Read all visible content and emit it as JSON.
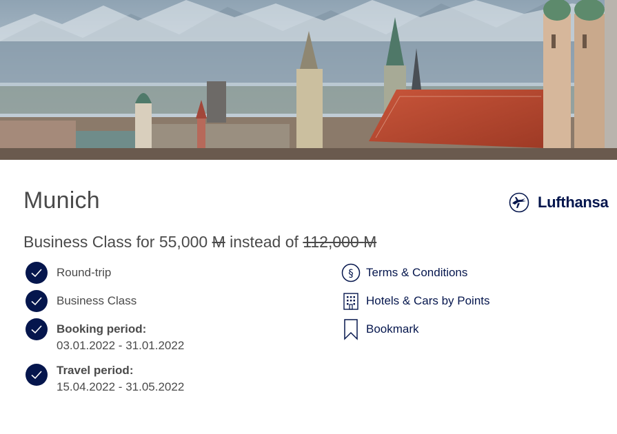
{
  "destination": {
    "title": "Munich"
  },
  "brand": {
    "name": "Lufthansa",
    "logo_icon": "crane-logo-icon",
    "color": "#05164d"
  },
  "offer": {
    "prefix": "Business Class for 55,000",
    "unit": "M",
    "middle": "instead of",
    "old_price": "112,000",
    "old_unit": "M"
  },
  "features": [
    {
      "label": "Round-trip",
      "icon": "checkmark-icon"
    },
    {
      "label": "Business Class",
      "icon": "checkmark-icon"
    },
    {
      "heading": "Booking period:",
      "value": "03.01.2022 - 31.01.2022",
      "icon": "checkmark-icon"
    },
    {
      "heading": "Travel period:",
      "value": "15.04.2022 - 31.05.2022",
      "icon": "checkmark-icon"
    }
  ],
  "links": [
    {
      "label": "Terms & Conditions",
      "icon": "paragraph-icon"
    },
    {
      "label": "Hotels & Cars by Points",
      "icon": "hotel-building-icon"
    },
    {
      "label": "Bookmark",
      "icon": "bookmark-icon"
    }
  ],
  "colors": {
    "accent": "#05164d",
    "text": "#4a4a4a"
  }
}
